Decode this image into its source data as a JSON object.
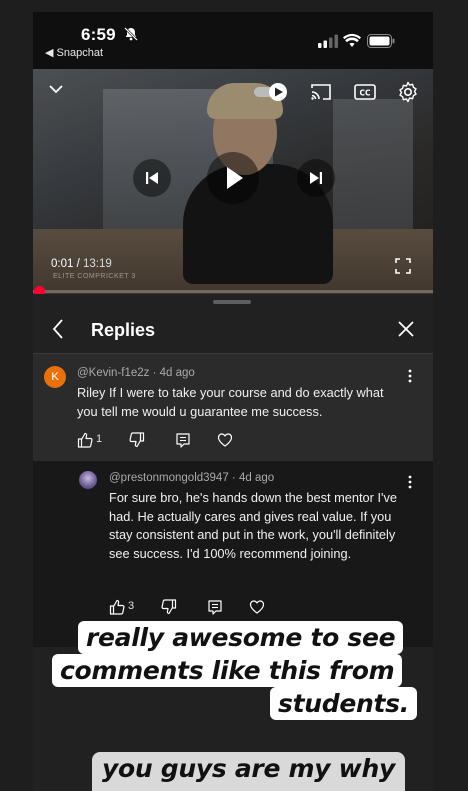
{
  "status_bar": {
    "time": "6:59",
    "back_app": "◀ Snapchat"
  },
  "video": {
    "current_time": "0:01",
    "separator": " / ",
    "duration": "13:19",
    "watermark": "ELITE COMPRICKET 3",
    "progress_percent": 0.1
  },
  "replies": {
    "title": "Replies",
    "comments": [
      {
        "author": "@Kevin-f1e2z",
        "age": "4d ago",
        "avatar_letter": "K",
        "text": "Riley If I were to take your course and do exactly what you tell me would u guarantee me success.",
        "likes": "1"
      },
      {
        "author": "@prestonmongold3947",
        "age": "4d ago",
        "text": "For sure bro, he's hands down the best mentor I've had. He actually cares and gives real value. If you stay consistent and put in the work, you'll definitely see success. I'd 100% recommend joining.",
        "likes": "3"
      }
    ]
  },
  "captions": {
    "line1": "really awesome to see",
    "line2": "comments like this from",
    "line3": "students.",
    "line4": "you guys are my why"
  },
  "colors": {
    "progress": "#ff0033",
    "avatar_k": "#e8710a",
    "panel_bg": "#212121"
  }
}
